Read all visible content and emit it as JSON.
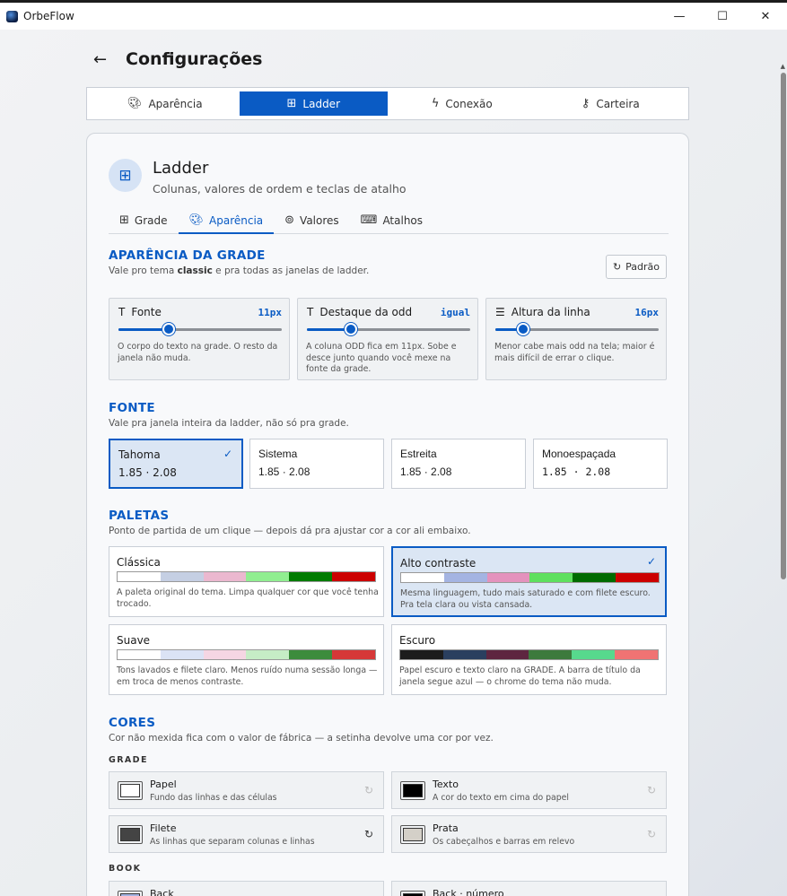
{
  "window": {
    "title": "OrbeFlow",
    "minimize_glyph": "—",
    "maximize_glyph": "☐",
    "close_glyph": "✕"
  },
  "header": {
    "title": "Configurações"
  },
  "main_tabs": [
    {
      "label": "Aparência",
      "icon": "palette-icon",
      "active": false
    },
    {
      "label": "Ladder",
      "icon": "grid-icon",
      "active": true
    },
    {
      "label": "Conexão",
      "icon": "bolt-icon",
      "active": false
    },
    {
      "label": "Carteira",
      "icon": "key-icon",
      "active": false
    }
  ],
  "section": {
    "title": "Ladder",
    "subtitle": "Colunas, valores de ordem e teclas de atalho"
  },
  "sub_tabs": [
    {
      "label": "Grade",
      "icon": "grid-icon",
      "active": false
    },
    {
      "label": "Aparência",
      "icon": "palette-icon",
      "active": true
    },
    {
      "label": "Valores",
      "icon": "coins-icon",
      "active": false
    },
    {
      "label": "Atalhos",
      "icon": "keyboard-icon",
      "active": false
    }
  ],
  "grid_appearance": {
    "heading": "APARÊNCIA DA GRADE",
    "desc_prefix": "Vale pro tema ",
    "desc_theme": "classic",
    "desc_suffix": " e pra todas as janelas de ladder.",
    "reset_label": "Padrão",
    "sliders": [
      {
        "label": "Fonte",
        "value": "11px",
        "level": 0.31,
        "help": "O corpo do texto na grade. O resto da janela não muda."
      },
      {
        "label": "Destaque da odd",
        "value": "igual",
        "level": 0.27,
        "help": "A coluna ODD fica em 11px. Sobe e desce junto quando você mexe na fonte da grade."
      },
      {
        "label": "Altura da linha",
        "value": "16px",
        "level": 0.17,
        "help": "Menor cabe mais odd na tela; maior é mais difícil de errar o clique."
      }
    ]
  },
  "font_section": {
    "heading": "FONTE",
    "desc": "Vale pra janela inteira da ladder, não só pra grade.",
    "options": [
      {
        "name": "Tahoma",
        "sample": "1.85 · 2.08",
        "selected": true
      },
      {
        "name": "Sistema",
        "sample": "1.85 · 2.08",
        "selected": false
      },
      {
        "name": "Estreita",
        "sample": "1.85 · 2.08",
        "selected": false
      },
      {
        "name": "Monoespaçada",
        "sample": "1.85 · 2.08",
        "selected": false
      }
    ]
  },
  "palettes": {
    "heading": "PALETAS",
    "desc": "Ponto de partida de um clique — depois dá pra ajustar cor a cor ali embaixo.",
    "items": [
      {
        "name": "Clássica",
        "selected": false,
        "colors": [
          "#ffffff",
          "#c5cfe3",
          "#ebb8cf",
          "#90ee90",
          "#007b00",
          "#cc0000"
        ],
        "help": "A paleta original do tema. Limpa qualquer cor que você tenha trocado."
      },
      {
        "name": "Alto contraste",
        "selected": true,
        "colors": [
          "#ffffff",
          "#a4b4e2",
          "#e492bd",
          "#5ee05e",
          "#006b00",
          "#cc0000"
        ],
        "help": "Mesma linguagem, tudo mais saturado e com filete escuro. Pra tela clara ou vista cansada."
      },
      {
        "name": "Suave",
        "selected": false,
        "colors": [
          "#ffffff",
          "#dbe3f5",
          "#f5d6e3",
          "#c6edc6",
          "#3c8c3c",
          "#d63838"
        ],
        "help": "Tons lavados e filete claro. Menos ruído numa sessão longa — em troca de menos contraste."
      },
      {
        "name": "Escuro",
        "selected": false,
        "colors": [
          "#1c1c1c",
          "#2a3f5f",
          "#5e2540",
          "#3d7a3d",
          "#57d98d",
          "#f07373"
        ],
        "help": "Papel escuro e texto claro na GRADE. A barra de título da janela segue azul — o chrome do tema não muda."
      }
    ]
  },
  "colors": {
    "heading": "CORES",
    "desc": "Cor não mexida fica com o valor de fábrica — a setinha devolve uma cor por vez.",
    "group_grade": "GRADE",
    "group_book": "BOOK",
    "grade_items": [
      {
        "name": "Papel",
        "help": "Fundo das linhas e das células",
        "color": "#ffffff",
        "modified": false
      },
      {
        "name": "Texto",
        "help": "A cor do texto em cima do papel",
        "color": "#000000",
        "modified": false
      },
      {
        "name": "Filete",
        "help": "As linhas que separam colunas e linhas",
        "color": "#444444",
        "modified": true
      },
      {
        "name": "Prata",
        "help": "Os cabeçalhos e barras em relevo",
        "color": "#d4d0c8",
        "modified": false
      }
    ],
    "book_items": [
      {
        "name": "Back",
        "color": "#a4b4e2",
        "modified": true
      },
      {
        "name": "Back · número",
        "color": "#000000",
        "modified": true
      }
    ]
  }
}
